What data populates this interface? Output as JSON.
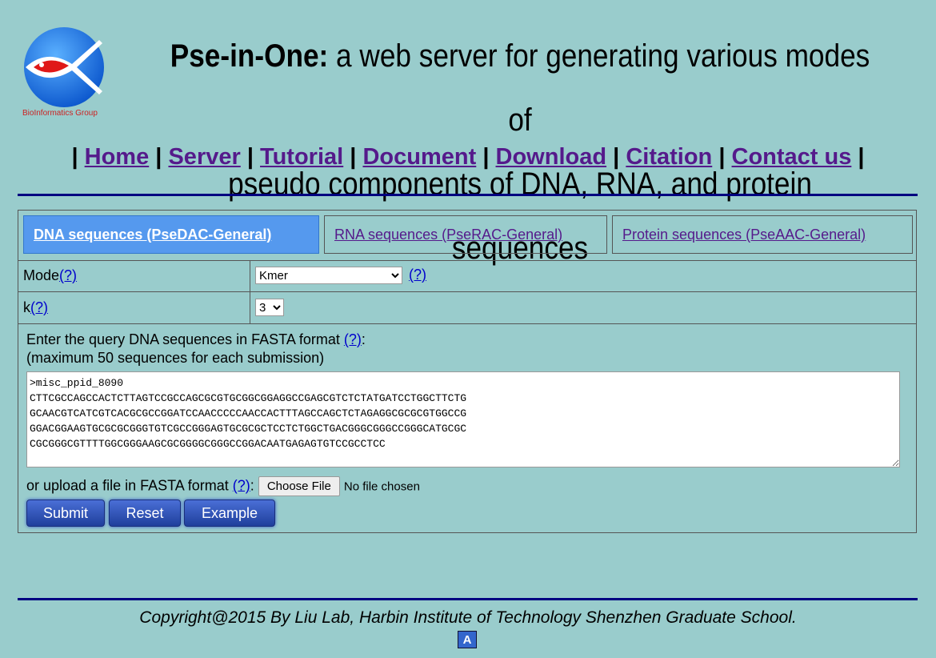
{
  "header": {
    "logo_text": "BioInformatics Group",
    "title_bold": "Pse-in-One:",
    "title_line1_rest": " a web server for generating various modes of",
    "title_line2": "pseudo components of DNA, RNA, and protein sequences"
  },
  "nav": {
    "sep": "|",
    "items": [
      "Home",
      "Server",
      "Tutorial",
      "Document",
      "Download",
      "Citation",
      "Contact us"
    ]
  },
  "tabs": [
    {
      "label": "DNA sequences (PseDAC-General)",
      "active": true
    },
    {
      "label": "RNA sequences (PseRAC-General)",
      "active": false
    },
    {
      "label": "Protein sequences (PseAAC-General)",
      "active": false
    }
  ],
  "form": {
    "mode_label": "Mode",
    "help": "(?)",
    "mode_value": "Kmer",
    "k_label": "k",
    "k_value": "3",
    "query_line1": "Enter the query DNA sequences in FASTA format ",
    "query_colon": ":",
    "query_line2": "(maximum 50 sequences for each submission)",
    "sequence_text": ">misc_ppid_8090\nCTTCGCCAGCCACTCTTAGTCCGCCAGCGCGTGCGGCGGAGGCCGAGCGTCTCTATGATCCTGGCTTCTG\nGCAACGTCATCGTCACGCGCCGGATCCAACCCCCAACCACTTTAGCCAGCTCTAGAGGCGCGCGTGGCCG\nGGACGGAAGTGCGCGCGGGTGTCGCCGGGAGTGCGCGCTCCTCTGGCTGACGGGCGGGCCGGGCATGCGC\nCGCGGGCGTTTTGGCGGGAAGCGCGGGGCGGGCCGGACAATGAGAGTGTCCGCCTCC",
    "upload_label": "or upload a file in FASTA format ",
    "choose_file": "Choose File",
    "no_file": "No file chosen",
    "submit": "Submit",
    "reset": "Reset",
    "example": "Example"
  },
  "footer": {
    "copyright": "Copyright@2015 By Liu Lab, Harbin Institute of Technology Shenzhen Graduate School.",
    "icon_letter": "A"
  },
  "colors": {
    "background": "#99cccc",
    "active_tab": "#5599ee",
    "rule": "#000080",
    "button": "#2a4fb8"
  }
}
